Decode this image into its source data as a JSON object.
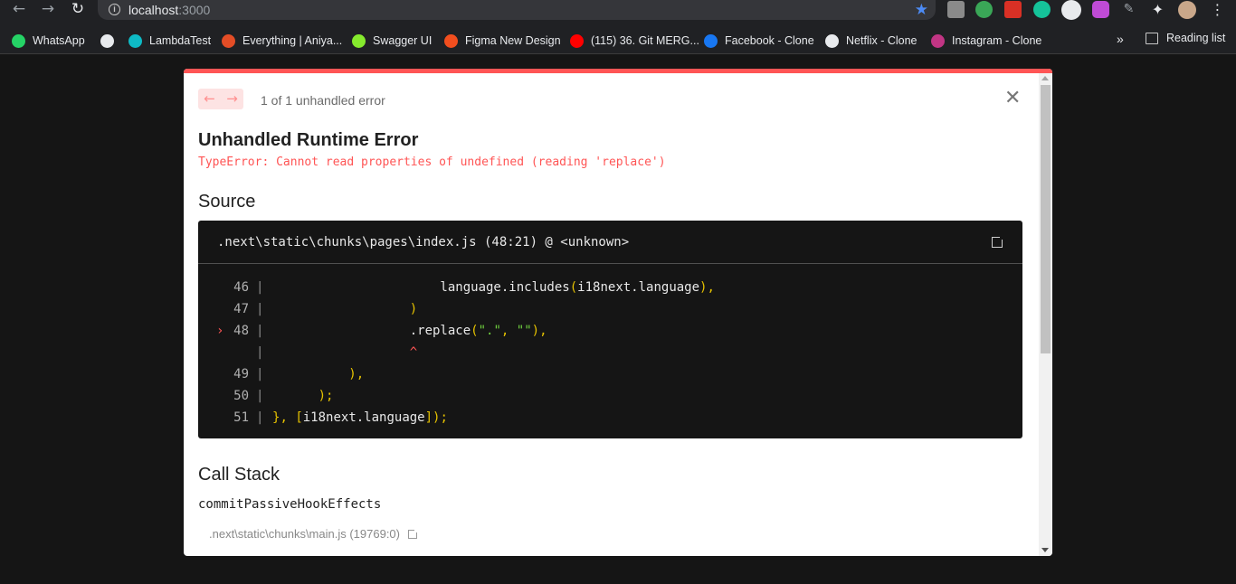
{
  "browser": {
    "url_host": "localhost",
    "url_port": ":3000",
    "bookmarks": [
      {
        "label": "WhatsApp",
        "icon": "whatsapp-icon",
        "color": "#25d366"
      },
      {
        "label": "",
        "icon": "globe-icon",
        "color": "#e8eaed"
      },
      {
        "label": "LambdaTest",
        "icon": "lambdatest-icon",
        "color": "#0ebac5"
      },
      {
        "label": "Everything | Aniya...",
        "icon": "site-icon",
        "color": "#e44d26"
      },
      {
        "label": "Swagger UI",
        "icon": "swagger-icon",
        "color": "#85ea2d"
      },
      {
        "label": "Figma New Design",
        "icon": "figma-icon",
        "color": "#f24e1e"
      },
      {
        "label": "(115) 36. Git MERG...",
        "icon": "youtube-icon",
        "color": "#ff0000"
      },
      {
        "label": "Facebook - Clone",
        "icon": "facebook-icon",
        "color": "#1877f2"
      },
      {
        "label": "Netflix - Clone",
        "icon": "globe-icon",
        "color": "#e8eaed"
      },
      {
        "label": "Instagram - Clone",
        "icon": "instagram-icon",
        "color": "#c13584"
      }
    ],
    "more": "»",
    "reading_list": "Reading list"
  },
  "overlay": {
    "error_count": "1 of 1 unhandled error",
    "title": "Unhandled Runtime Error",
    "message": "TypeError: Cannot read properties of undefined (reading 'replace')",
    "source_heading": "Source",
    "source_file": ".next\\static\\chunks\\pages\\index.js (48:21) @ <unknown>",
    "code_lines": [
      {
        "num": "46",
        "text": "                      language.includes(i18next.language),"
      },
      {
        "num": "47",
        "text": "                  )"
      },
      {
        "num": "48",
        "text": "                  .replace(\".\", \"\"),",
        "active": true
      },
      {
        "num": "",
        "text": "                  ^"
      },
      {
        "num": "49",
        "text": "          ),"
      },
      {
        "num": "50",
        "text": "      );"
      },
      {
        "num": "51",
        "text": "}, [i18next.language]);"
      }
    ],
    "callstack_heading": "Call Stack",
    "stack_function": "commitPassiveHookEffects",
    "stack_location": ".next\\static\\chunks\\main.js (19769:0)"
  },
  "colors": {
    "accent_error": "#ff5555",
    "code_bg": "#151515"
  }
}
